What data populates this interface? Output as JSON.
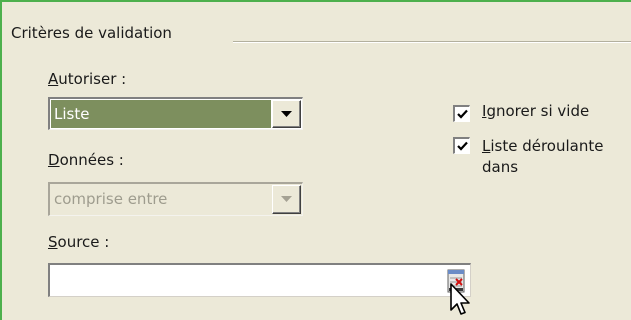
{
  "group": {
    "title": "Critères de validation"
  },
  "autoriser": {
    "accel": "A",
    "label_rest": "utoriser :",
    "value": "Liste"
  },
  "donnees": {
    "accel": "D",
    "label_rest": "onnées :",
    "value": "comprise entre"
  },
  "source": {
    "accel": "S",
    "label_rest": "ource :",
    "value": ""
  },
  "options": {
    "ignore_blank": {
      "accel": "I",
      "label_rest": "gnorer si vide",
      "checked": true
    },
    "dropdown": {
      "accel": "L",
      "label_rest": "iste déroulante",
      "label_line2": "dans",
      "checked": true
    }
  },
  "colors": {
    "selection": "#7d8f5e",
    "frame_accent": "#4db04d"
  }
}
